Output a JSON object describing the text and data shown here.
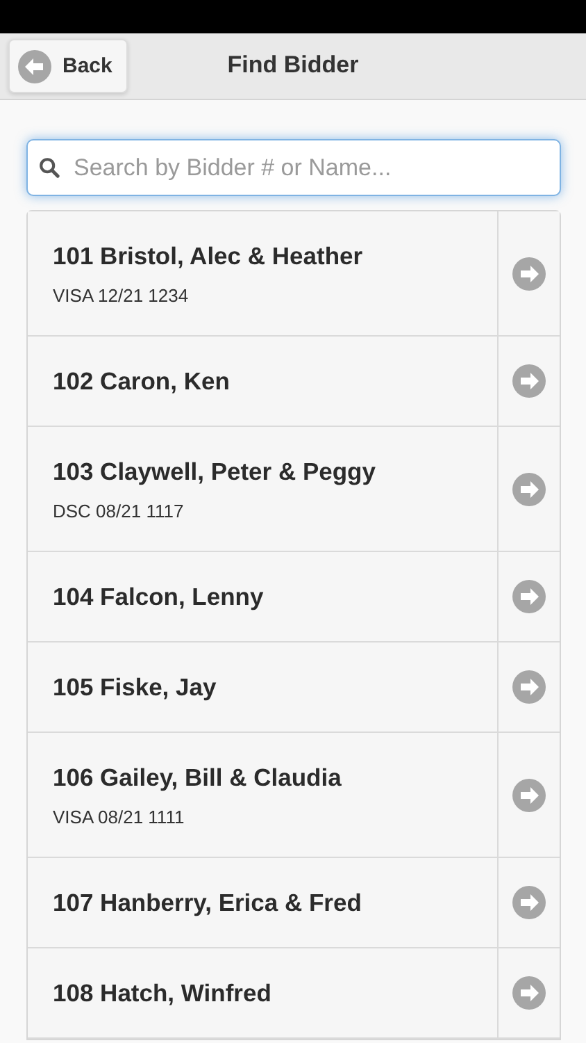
{
  "header": {
    "back_button": "Back",
    "title": "Find Bidder"
  },
  "search": {
    "placeholder": "Search by Bidder # or Name..."
  },
  "bidders": [
    {
      "name": "101 Bristol, Alec & Heather",
      "card": "VISA 12/21 1234"
    },
    {
      "name": "102 Caron, Ken"
    },
    {
      "name": "103 Claywell, Peter & Peggy",
      "card": "DSC 08/21 1117"
    },
    {
      "name": "104 Falcon, Lenny"
    },
    {
      "name": "105 Fiske, Jay"
    },
    {
      "name": "106 Gailey, Bill & Claudia",
      "card": "VISA 08/21 1111"
    },
    {
      "name": "107 Hanberry, Erica & Fred"
    },
    {
      "name": "108 Hatch, Winfred"
    }
  ]
}
